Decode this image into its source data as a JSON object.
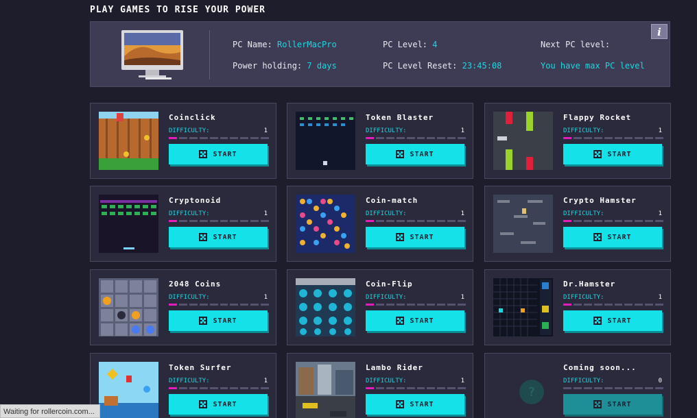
{
  "page": {
    "title": "Play games to rise your power"
  },
  "pc": {
    "name_label": "PC Name:",
    "name_value": "RollerMacPro",
    "power_label": "Power holding:",
    "power_value": "7 days",
    "level_label": "PC Level:",
    "level_value": "4",
    "reset_label": "PC Level Reset:",
    "reset_value": "23:45:08",
    "next_label": "Next PC level:",
    "next_value": "You have max PC level",
    "info_label": "i"
  },
  "games": [
    {
      "title": "Coinclick",
      "difficulty_label": "DIFFICULTY:",
      "difficulty": "1",
      "difficulty_level": 1,
      "start_label": "START"
    },
    {
      "title": "Token Blaster",
      "difficulty_label": "DIFFICULTY:",
      "difficulty": "1",
      "difficulty_level": 1,
      "start_label": "START"
    },
    {
      "title": "Flappy Rocket",
      "difficulty_label": "DIFFICULTY:",
      "difficulty": "1",
      "difficulty_level": 1,
      "start_label": "START"
    },
    {
      "title": "Cryptonoid",
      "difficulty_label": "DIFFICULTY:",
      "difficulty": "1",
      "difficulty_level": 1,
      "start_label": "START"
    },
    {
      "title": "Coin-match",
      "difficulty_label": "DIFFICULTY:",
      "difficulty": "1",
      "difficulty_level": 1,
      "start_label": "START"
    },
    {
      "title": "Crypto Hamster",
      "difficulty_label": "DIFFICULTY:",
      "difficulty": "1",
      "difficulty_level": 1,
      "start_label": "START"
    },
    {
      "title": "2048 Coins",
      "difficulty_label": "DIFFICULTY:",
      "difficulty": "1",
      "difficulty_level": 1,
      "start_label": "START"
    },
    {
      "title": "Coin-Flip",
      "difficulty_label": "DIFFICULTY:",
      "difficulty": "1",
      "difficulty_level": 1,
      "start_label": "START"
    },
    {
      "title": "Dr.Hamster",
      "difficulty_label": "DIFFICULTY:",
      "difficulty": "1",
      "difficulty_level": 1,
      "start_label": "START"
    },
    {
      "title": "Token Surfer",
      "difficulty_label": "DIFFICULTY:",
      "difficulty": "1",
      "difficulty_level": 1,
      "start_label": "START"
    },
    {
      "title": "Lambo Rider",
      "difficulty_label": "DIFFICULTY:",
      "difficulty": "1",
      "difficulty_level": 1,
      "start_label": "START"
    },
    {
      "title": "Coming soon...",
      "difficulty_label": "DIFFICULTY:",
      "difficulty": "0",
      "difficulty_level": 0,
      "start_label": "START"
    }
  ],
  "browser": {
    "status": "Waiting for rollercoin.com..."
  },
  "colors": {
    "accent": "#13e3e9",
    "difficulty_bar": "#e41cbd",
    "panel": "#3e3c54",
    "background": "#1e1d2b"
  }
}
